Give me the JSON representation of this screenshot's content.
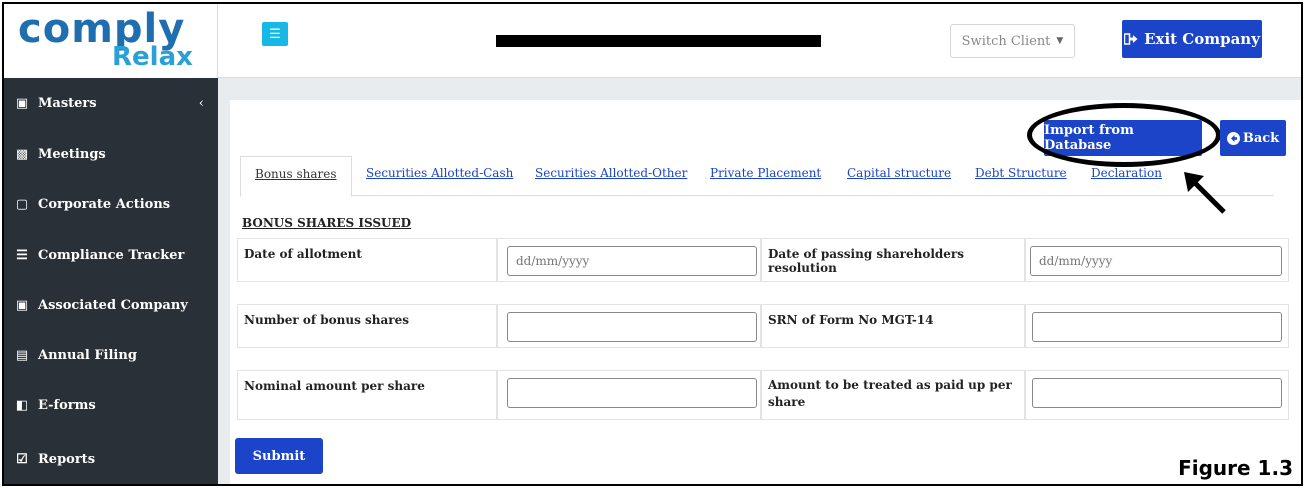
{
  "logo": {
    "line1": "comply",
    "line2": "Relax"
  },
  "header": {
    "menu_icon": "hamburger-icon",
    "company_name": "",
    "switch_client": "Switch Client",
    "exit_company": "Exit Company"
  },
  "sidebar": {
    "items": [
      {
        "label": "Masters",
        "icon": "building-icon"
      },
      {
        "label": "Meetings",
        "icon": "briefcase-icon"
      },
      {
        "label": "Corporate Actions",
        "icon": "monitor-icon"
      },
      {
        "label": "Compliance Tracker",
        "icon": "list-icon"
      },
      {
        "label": "Associated Company",
        "icon": "building-icon"
      },
      {
        "label": "Annual Filing",
        "icon": "file-icon"
      },
      {
        "label": "E-forms",
        "icon": "external-link-icon"
      },
      {
        "label": "Reports",
        "icon": "checkbox-icon"
      }
    ]
  },
  "actions": {
    "import": "Import from Database",
    "back": "Back"
  },
  "tabs": [
    "Bonus shares",
    "Securities Allotted-Cash",
    "Securities Allotted-Other",
    "Private Placement",
    "Capital structure",
    "Debt Structure",
    "Declaration"
  ],
  "form": {
    "section_title": "BONUS SHARES ISSUED",
    "date_of_allotment": {
      "label": "Date of allotment",
      "placeholder": "dd/mm/yyyy"
    },
    "date_resolution": {
      "label": "Date of passing shareholders resolution",
      "placeholder": "dd/mm/yyyy"
    },
    "number_bonus": {
      "label": "Number of bonus shares",
      "value": ""
    },
    "srn_mgt14": {
      "label": "SRN of Form No MGT-14",
      "value": ""
    },
    "nominal_amount": {
      "label": "Nominal amount per share",
      "value": ""
    },
    "paid_up_amount": {
      "label": "Amount to be treated as paid up per share",
      "value": ""
    },
    "submit": "Submit"
  },
  "caption": "Figure 1.3",
  "colors": {
    "primary": "#1b44c8",
    "sidebar": "#2a3038",
    "menu_button": "#17b8e6"
  }
}
